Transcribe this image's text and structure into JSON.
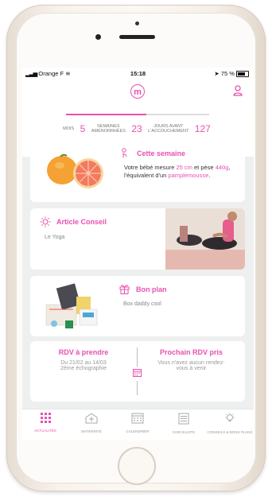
{
  "status_bar": {
    "carrier": "Orange F",
    "time": "15:18",
    "battery": "75 %"
  },
  "header": {
    "logo_letter": "m",
    "progress_fraction": 0.56,
    "stats": {
      "months_label": "MOIS",
      "months_value": "5",
      "weeks_label_1": "SEMAINES",
      "weeks_label_2": "AMÉNORRHÉES",
      "weeks_value": "23",
      "days_label_1": "JOURS AVANT",
      "days_label_2": "L'ACCOUCHEMENT",
      "days_value": "127"
    }
  },
  "week_card": {
    "title": "Cette semaine",
    "text_1": "Votre bébé mesure ",
    "size": "25 cm",
    "text_2": " et pèse ",
    "weight": "440g",
    "text_3": ", l'équivalent d'un ",
    "fruit": "pamplemousse",
    "text_4": "."
  },
  "article_card": {
    "title": "Article Conseil",
    "subtitle": "Le Yoga"
  },
  "deal_card": {
    "title": "Bon plan",
    "subtitle": "Box daddy cool"
  },
  "rdv_card": {
    "left_title": "RDV à prendre",
    "left_line_1": "Du 21/02 au 14/03",
    "left_line_2": "2ème échographie",
    "right_title": "Prochain RDV pris",
    "right_line_1": "Vous n'avez aucun rendez-",
    "right_line_2": "vous à venir"
  },
  "tabs": [
    {
      "label": "ACTUALITÉS",
      "icon": "grid-icon",
      "active": true
    },
    {
      "label": "MATERNITÉ",
      "icon": "hospital-icon",
      "active": false
    },
    {
      "label": "CALENDRIER",
      "icon": "calendar-icon",
      "active": false
    },
    {
      "label": "CHECKLISTE",
      "icon": "checklist-icon",
      "active": false
    },
    {
      "label": "CONSEILS & BONS PLANS",
      "icon": "lightbulb-icon",
      "active": false
    }
  ],
  "colors": {
    "accent": "#e94fb1",
    "background": "#eef0f0"
  }
}
